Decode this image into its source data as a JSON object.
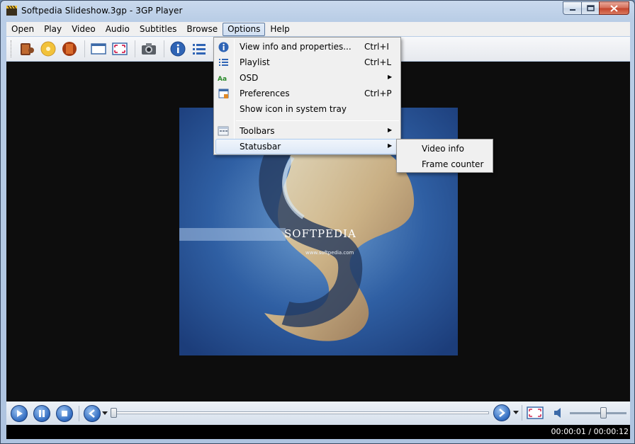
{
  "window": {
    "title": "Softpedia Slideshow.3gp - 3GP Player"
  },
  "menubar": {
    "items": [
      "Open",
      "Play",
      "Video",
      "Audio",
      "Subtitles",
      "Browse",
      "Options",
      "Help"
    ],
    "active": "Options"
  },
  "toolbar": {
    "icons": [
      "open-file-icon",
      "open-disc-icon",
      "open-url-icon",
      "window-mode-icon",
      "fullscreen-icon",
      "screenshot-icon",
      "info-icon",
      "playlist-icon",
      "preferences-icon"
    ]
  },
  "options_menu": {
    "items": [
      {
        "label": "View info and properties...",
        "shortcut": "Ctrl+I",
        "icon": "info-icon"
      },
      {
        "label": "Playlist",
        "shortcut": "Ctrl+L",
        "icon": "playlist-icon"
      },
      {
        "label": "OSD",
        "shortcut": "",
        "icon": "osd-icon",
        "submenu": true
      },
      {
        "label": "Preferences",
        "shortcut": "Ctrl+P",
        "icon": "preferences-icon"
      },
      {
        "label": "Show icon in system tray",
        "shortcut": "",
        "icon": ""
      },
      {
        "label": "Toolbars",
        "shortcut": "",
        "icon": "toolbars-icon",
        "submenu": true
      },
      {
        "label": "Statusbar",
        "shortcut": "",
        "icon": "",
        "submenu": true,
        "highlighted": true
      }
    ]
  },
  "statusbar_submenu": {
    "items": [
      "Video info",
      "Frame counter"
    ]
  },
  "video": {
    "watermark": "SOFTPEDIA",
    "url": "www.softpedia.com"
  },
  "playback": {
    "seek_position": 0.0,
    "volume_level": 0.6
  },
  "status": {
    "time": "00:00:01 / 00:00:12"
  },
  "colors": {
    "title_bg": "#c4d5eb",
    "menu_bg": "#f0f0f0",
    "video_bg": "#0d0d0d",
    "accent_blue": "#3771c4",
    "status_bg": "#000000"
  }
}
